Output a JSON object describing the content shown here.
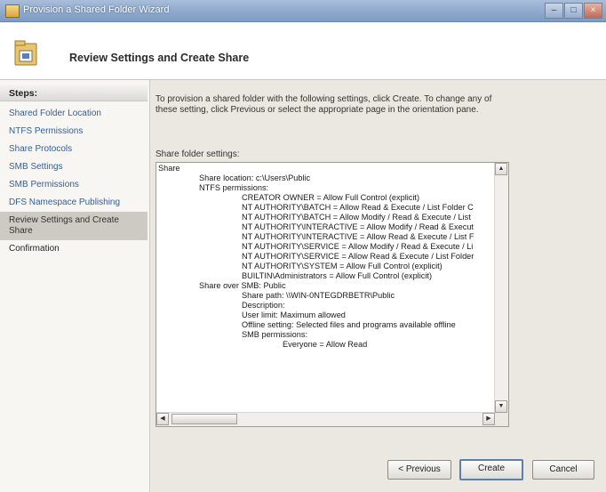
{
  "window": {
    "title": "Provision a Shared Folder Wizard"
  },
  "header": {
    "title": "Review Settings and Create Share"
  },
  "nav": {
    "header": "Steps:",
    "items": [
      {
        "label": "Shared Folder Location",
        "state": "link"
      },
      {
        "label": "NTFS Permissions",
        "state": "link"
      },
      {
        "label": "Share Protocols",
        "state": "link"
      },
      {
        "label": "SMB Settings",
        "state": "link"
      },
      {
        "label": "SMB Permissions",
        "state": "link"
      },
      {
        "label": "DFS Namespace Publishing",
        "state": "link"
      },
      {
        "label": "Review Settings and Create Share",
        "state": "active"
      },
      {
        "label": "Confirmation",
        "state": "plain"
      }
    ]
  },
  "content": {
    "intro": "To provision a shared folder with the following settings, click Create. To change any of these setting, click Previous or select the appropriate page in the orientation pane.",
    "settings_label": "Share folder settings:",
    "settings_lines": [
      "Share",
      "Share location: c:\\Users\\Public",
      "NTFS permissions:",
      "CREATOR OWNER = Allow Full Control (explicit)",
      "NT AUTHORITY\\BATCH = Allow Read & Execute / List Folder C",
      "NT AUTHORITY\\BATCH = Allow Modify / Read & Execute / List",
      "NT AUTHORITY\\INTERACTIVE = Allow Modify / Read & Execut",
      "NT AUTHORITY\\INTERACTIVE = Allow Read & Execute / List F",
      "NT AUTHORITY\\SERVICE = Allow Modify / Read & Execute / Li",
      "NT AUTHORITY\\SERVICE = Allow Read & Execute / List Folder",
      "NT AUTHORITY\\SYSTEM = Allow Full Control (explicit)",
      "BUILTIN\\Administrators = Allow Full Control (explicit)",
      "Share over SMB: Public",
      "Share path: \\\\WIN-0NTEGDRBETR\\Public",
      "Description:",
      "User limit: Maximum allowed",
      "Offline setting: Selected files and programs available offline",
      "SMB permissions:",
      "Everyone = Allow Read"
    ]
  },
  "footer": {
    "previous_label": "< Previous",
    "create_label": "Create",
    "cancel_label": "Cancel"
  },
  "icons": {
    "window": "folder-app-icon",
    "header": "shared-folder-wizard-icon",
    "min": "minimize-icon",
    "max": "maximize-icon",
    "close": "close-icon"
  },
  "colors": {
    "link": "#2f5f9f",
    "titlebar": "#8fa9cc",
    "active_step": "#cdcac4"
  }
}
